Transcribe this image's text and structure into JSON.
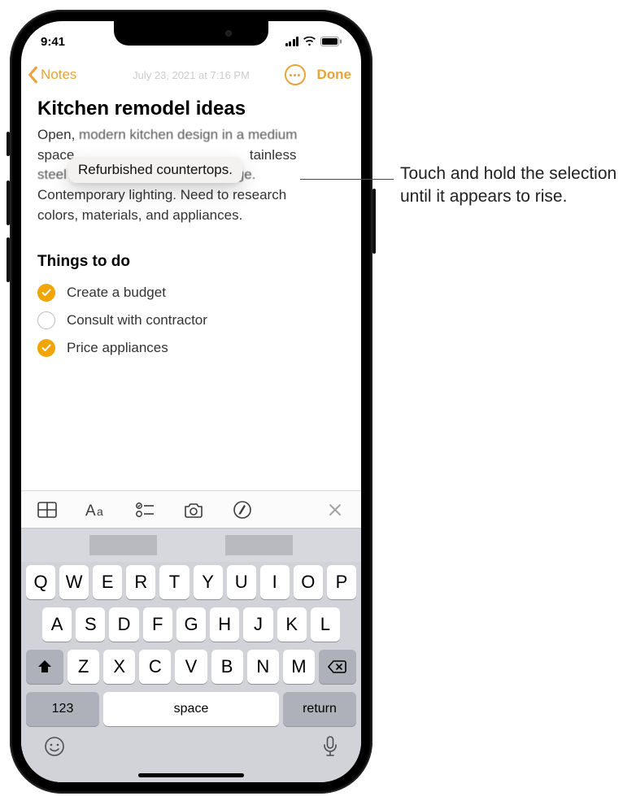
{
  "status": {
    "time": "9:41"
  },
  "nav": {
    "back_label": "Notes",
    "date": "July 23, 2021 at 7:16 PM",
    "done_label": "Done"
  },
  "note": {
    "title": "Kitchen remodel ideas",
    "body_l1_pre": "Open, ",
    "body_l1_blur": "modern kitchen design in a medium",
    "body_l2_pre": "space",
    "body_l2_post": "tainless",
    "body_l3_blur": "steel range hood. Plenty of storage.",
    "body_l4": "Contemporary lighting. Need to research",
    "body_l5": "colors, materials, and appliances.",
    "floating_text": "Refurbished countertops.",
    "section_heading": "Things to do",
    "checklist": [
      {
        "label": "Create a budget",
        "checked": true
      },
      {
        "label": "Consult with contractor",
        "checked": false
      },
      {
        "label": "Price appliances",
        "checked": true
      }
    ]
  },
  "keyboard": {
    "row1": [
      "Q",
      "W",
      "E",
      "R",
      "T",
      "Y",
      "U",
      "I",
      "O",
      "P"
    ],
    "row2": [
      "A",
      "S",
      "D",
      "F",
      "G",
      "H",
      "J",
      "K",
      "L"
    ],
    "row3": [
      "Z",
      "X",
      "C",
      "V",
      "B",
      "N",
      "M"
    ],
    "key_123": "123",
    "key_space": "space",
    "key_return": "return"
  },
  "callout": {
    "text": "Touch and hold the selection until it appears to rise."
  }
}
